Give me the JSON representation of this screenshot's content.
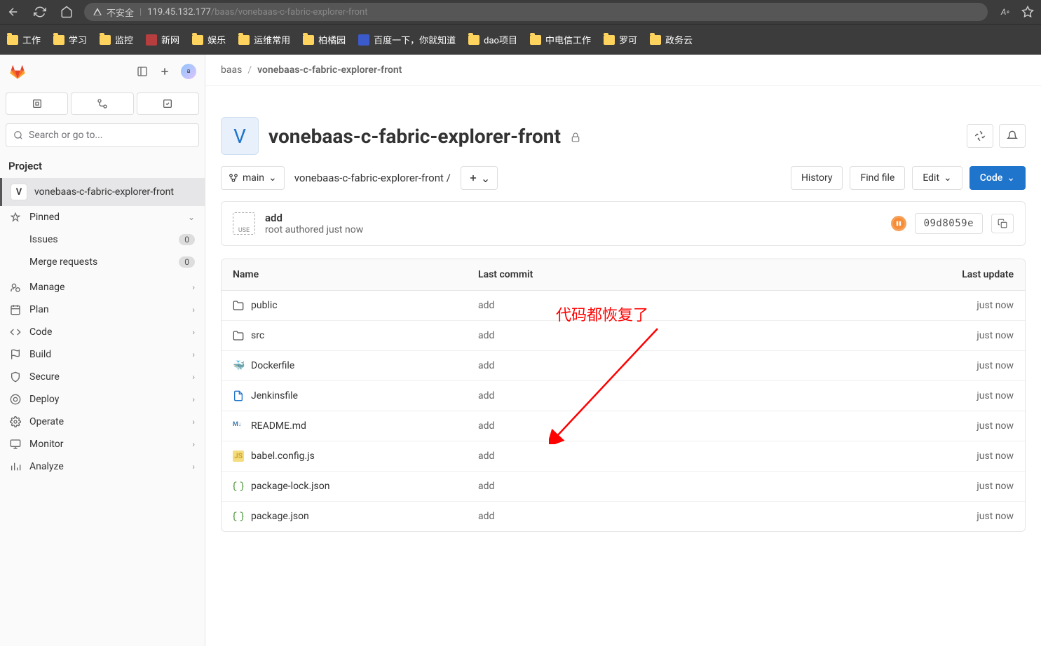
{
  "browser": {
    "url_warn": "不安全",
    "url_host": "119.45.132.177",
    "url_path": "/baas/vonebaas-c-fabric-explorer-front"
  },
  "bookmarks": [
    "工作",
    "学习",
    "监控",
    "新网",
    "娱乐",
    "运维常用",
    "柏橘园",
    "百度一下，你就知道",
    "dao项目",
    "中电信工作",
    "罗可",
    "政务云"
  ],
  "sidebar": {
    "search_placeholder": "Search or go to...",
    "section_label": "Project",
    "project": {
      "initial": "V",
      "name": "vonebaas-c-fabric-explorer-front"
    },
    "pinned_label": "Pinned",
    "pinned_items": [
      {
        "label": "Issues",
        "count": "0"
      },
      {
        "label": "Merge requests",
        "count": "0"
      }
    ],
    "nav": [
      "Manage",
      "Plan",
      "Code",
      "Build",
      "Secure",
      "Deploy",
      "Operate",
      "Monitor",
      "Analyze"
    ]
  },
  "breadcrumb": {
    "group": "baas",
    "project": "vonebaas-c-fabric-explorer-front"
  },
  "project_header": {
    "initial": "V",
    "title": "vonebaas-c-fabric-explorer-front"
  },
  "toolbar": {
    "branch": "main",
    "path": "vonebaas-c-fabric-explorer-front",
    "history": "History",
    "find_file": "Find file",
    "edit": "Edit",
    "code": "Code"
  },
  "commit": {
    "message": "add",
    "author": "root authored just now",
    "sha": "09d8059e"
  },
  "table": {
    "cols": {
      "name": "Name",
      "commit": "Last commit",
      "update": "Last update"
    },
    "rows": [
      {
        "icon": "folder",
        "name": "public",
        "commit": "add",
        "update": "just now"
      },
      {
        "icon": "folder",
        "name": "src",
        "commit": "add",
        "update": "just now"
      },
      {
        "icon": "docker",
        "name": "Dockerfile",
        "commit": "add",
        "update": "just now"
      },
      {
        "icon": "doc",
        "name": "Jenkinsfile",
        "commit": "add",
        "update": "just now"
      },
      {
        "icon": "md",
        "name": "README.md",
        "commit": "add",
        "update": "just now"
      },
      {
        "icon": "js",
        "name": "babel.config.js",
        "commit": "add",
        "update": "just now"
      },
      {
        "icon": "json",
        "name": "package-lock.json",
        "commit": "add",
        "update": "just now"
      },
      {
        "icon": "json",
        "name": "package.json",
        "commit": "add",
        "update": "just now"
      }
    ]
  },
  "annotation": "代码都恢复了"
}
